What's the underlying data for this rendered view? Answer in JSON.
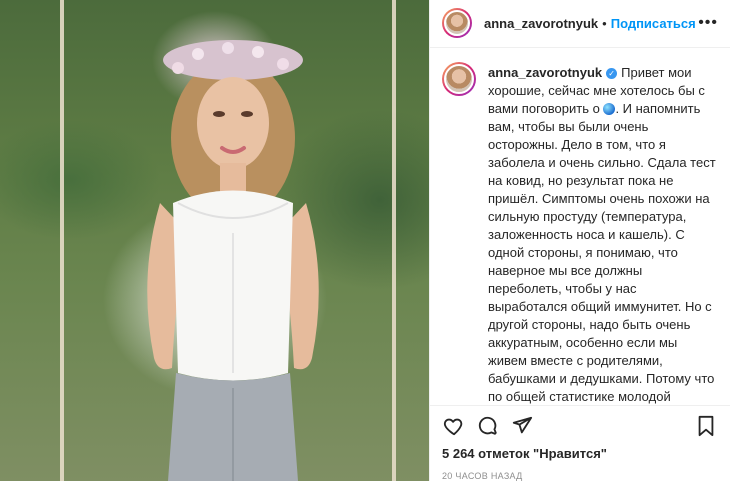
{
  "header": {
    "username": "anna_zavorotnyuk",
    "separator": "•",
    "follow_label": "Подписаться",
    "more_label": "•••"
  },
  "caption": {
    "username": "anna_zavorotnyuk",
    "verified_label": "✓",
    "text_1": "Привет мои хорошие, сейчас мне хотелось бы с вами поговорить о",
    "text_2": ". И напомнить вам, чтобы вы были очень осторожны. Дело в том, что я заболела и очень сильно. Сдала тест на ковид, но результат пока не пришёл. Симптомы очень похожи на сильную простуду (температура, заложенность носа и кашель). С одной стороны, я понимаю, что наверное мы все должны переболеть, чтобы у нас выработался общий иммунитет. Но с другой стороны, надо быть очень аккуратным, особенно если мы живем вместе с родителями, бабушками и дедушками. Потому что по общей статистике молодой организм гораздо проще"
  },
  "actions": {
    "like": "heart-icon",
    "comment": "comment-icon",
    "share": "send-icon",
    "save": "bookmark-icon"
  },
  "likes_text": "5 264 отметок \"Нравится\"",
  "time_text": "20 часов назад"
}
